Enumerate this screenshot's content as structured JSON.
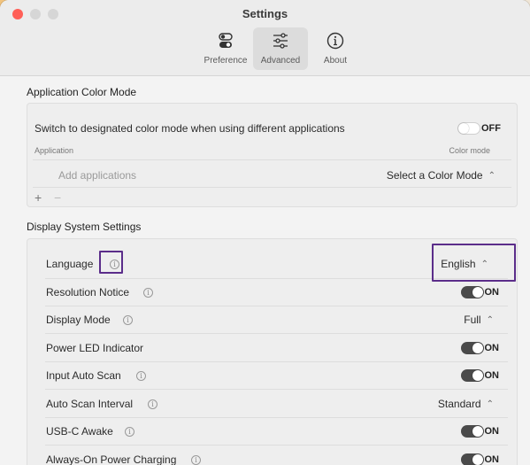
{
  "window": {
    "title": "Settings"
  },
  "toolbar": {
    "tabs": [
      {
        "label": "Preference",
        "icon": "toggles-icon"
      },
      {
        "label": "Advanced",
        "icon": "sliders-icon",
        "active": true
      },
      {
        "label": "About",
        "icon": "info-icon"
      }
    ]
  },
  "app_color_mode": {
    "section_title": "Application Color Mode",
    "switch_label": "Switch to designated color mode when using different applications",
    "switch_state": "OFF",
    "col_application": "Application",
    "col_color_mode": "Color mode",
    "add_placeholder": "Add applications",
    "select_placeholder": "Select a Color Mode",
    "add_button": "+",
    "remove_button": "−"
  },
  "display_settings": {
    "section_title": "Display System Settings",
    "rows": [
      {
        "label": "Language",
        "value": "English",
        "control": "select",
        "info": true
      },
      {
        "label": "Resolution Notice",
        "value": "ON",
        "control": "toggle",
        "info": true
      },
      {
        "label": "Display Mode",
        "value": "Full",
        "control": "select",
        "info": true
      },
      {
        "label": "Power LED Indicator",
        "value": "ON",
        "control": "toggle",
        "info": false
      },
      {
        "label": "Input Auto Scan",
        "value": "ON",
        "control": "toggle",
        "info": true
      },
      {
        "label": "Auto Scan Interval",
        "value": "Standard",
        "control": "select",
        "info": true
      },
      {
        "label": "USB-C Awake",
        "value": "ON",
        "control": "toggle",
        "info": true
      },
      {
        "label": "Always-On Power Charging",
        "value": "ON",
        "control": "toggle",
        "info": true
      }
    ]
  },
  "colors": {
    "highlight": "#5b2d8a",
    "toggle_on": "#4a4a4a",
    "close": "#ff5f57"
  }
}
